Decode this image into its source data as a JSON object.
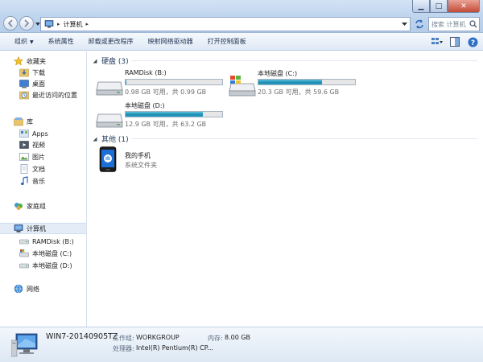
{
  "address": {
    "crumb": "计算机",
    "search_placeholder": "搜索 计算机"
  },
  "toolbar": {
    "items": [
      "组织",
      "系统属性",
      "卸载或更改程序",
      "映射网络驱动器",
      "打开控制面板"
    ]
  },
  "nav": {
    "favorites": "收藏夹",
    "fav_items": [
      "下载",
      "桌面",
      "最近访问的位置"
    ],
    "libraries": "库",
    "lib_items": [
      "Apps",
      "视频",
      "图片",
      "文档",
      "音乐"
    ],
    "homegroup": "家庭组",
    "computer": "计算机",
    "computer_items": [
      "RAMDisk (B:)",
      "本地磁盘 (C:)",
      "本地磁盘 (D:)"
    ],
    "network": "网络"
  },
  "sections": {
    "hdd": "硬盘 (3)",
    "other": "其他 (1)"
  },
  "drives": [
    {
      "name": "RAMDisk (B:)",
      "info": "0.98 GB 可用，共 0.99 GB",
      "used_fraction": 0.01
    },
    {
      "name": "本地磁盘 (C:)",
      "info": "20.3 GB 可用，共 59.6 GB",
      "used_fraction": 0.66
    },
    {
      "name": "本地磁盘 (D:)",
      "info": "12.9 GB 可用，共 63.2 GB",
      "used_fraction": 0.8
    }
  ],
  "other_items": [
    {
      "name": "我的手机",
      "type": "系统文件夹"
    }
  ],
  "details": {
    "machine_name": "WIN7-20140905TZ",
    "workgroup_label": "工作组:",
    "workgroup_value": "WORKGROUP",
    "memory_label": "内存:",
    "memory_value": "8.00 GB",
    "cpu_label": "处理器:",
    "cpu_value": "Intel(R) Pentium(R) CP..."
  },
  "colors": {
    "accent": "#1e395b",
    "bar_fill": "#26a0c8"
  }
}
